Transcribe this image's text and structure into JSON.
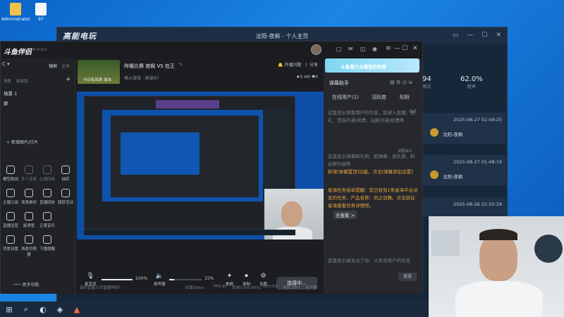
{
  "desktop": {
    "icons": [
      {
        "label": "Administrator",
        "icon": "folder-icon"
      },
      {
        "label": "97",
        "icon": "file-icon"
      }
    ]
  },
  "back_window": {
    "logo_text": "高能电玩",
    "title": "沈阳-夜枫 - 个人主页",
    "stats": [
      {
        "value": "94",
        "label": "场次"
      },
      {
        "value": "62.0%",
        "label": "胜率"
      }
    ],
    "matches": [
      {
        "datetime": "2025-08-27 02:09:25",
        "player": "沈阳-夜枫"
      },
      {
        "datetime": "2025-08-27 01:48:19",
        "player": "沈阳-夜枫"
      },
      {
        "datetime": "2025-08-26 22:50:29",
        "player": ""
      }
    ]
  },
  "app": {
    "name": "斗鱼伴侣",
    "version": "6.4.9.2",
    "sidebar": {
      "tabs": [
        "镜屏",
        "全屏"
      ],
      "section_a": "场景",
      "section_b": "画面层",
      "scene_item": "场景 1",
      "scene_sub": "屏",
      "add_scene": "新增图片/灯片",
      "tools": [
        {
          "label": "模型挑战",
          "icon": "shield-icon"
        },
        {
          "label": "多人连麦",
          "icon": "users-icon"
        },
        {
          "label": "主播回放",
          "icon": "replay-icon"
        },
        {
          "label": "抽奖",
          "icon": "gift-icon"
        },
        {
          "label": "主播口袋",
          "icon": "pocket-icon"
        },
        {
          "label": "场景素材",
          "icon": "scene-icon"
        },
        {
          "label": "直播回放",
          "icon": "clock-icon"
        },
        {
          "label": "跳跃活动",
          "icon": "jump-icon"
        },
        {
          "label": "直播运营",
          "icon": "ai-icon"
        },
        {
          "label": "旋律管",
          "icon": "music-icon"
        },
        {
          "label": "正版音乐",
          "icon": "download-icon"
        },
        {
          "label": "",
          "icon": "blank"
        },
        {
          "label": "背景设置",
          "icon": "bg-icon"
        },
        {
          "label": "场景切换器",
          "icon": "switch-icon"
        },
        {
          "label": "下播提醒",
          "icon": "bell-icon"
        },
        {
          "label": "",
          "icon": "blank"
        }
      ],
      "more": "更多功能"
    },
    "room": {
      "title": "昨晚比赛 夜枫 VS 包王",
      "category": "格斗游戏 · 斯曼97",
      "thumb_caption": "今日有凤来 双击",
      "broadcast_help": "开播问题",
      "share": "分享",
      "counts": [
        "0",
        "0",
        "0"
      ]
    },
    "controls": [
      {
        "label": "麦克风",
        "icon": "mic-icon",
        "value": "100%"
      },
      {
        "label": "扬声器",
        "icon": "speaker-icon",
        "value": "15%"
      },
      {
        "label": "美颜",
        "icon": "beauty-icon"
      },
      {
        "label": "录制",
        "icon": "record-icon"
      },
      {
        "label": "设置",
        "icon": "gear-icon"
      }
    ],
    "connect_button": "连接中...",
    "status": {
      "hint": "如何直播上手直播伴侣?",
      "bitrate": "码率0kb/s",
      "fps": "FPS:30",
      "drop": "丢帧0.0(0.00%)",
      "cpu": "CPU:5%",
      "mem": "内存:35%",
      "network": "未开播"
    },
    "right_panel": {
      "banner": "斗鱼潜力主播签约政策",
      "header": "弹幕助手",
      "tabs": [
        "在线用户(1)",
        "活跃度",
        "贴粉"
      ],
      "count_badge": "0.0",
      "count_badge2": "0页/0人",
      "placeholder_1": "这里显示观看用户的信息，如进入直播，送礼、贵族开通/续费，钻粉开通/续费等",
      "placeholder_2": "这里显示弹幕和礼物，如弹幕、送礼物、粉丝牌升级等",
      "notice_1": "新增[弹幕置顶]功能，点击[弹幕添加设置]",
      "notice_2": "星海任务接单提醒：您已收到1条星海平台派发的任务，产品名称：风之剑舞。点击前往星海查看任务详情吧。",
      "notice_link": "去查看 >",
      "placeholder_3": "这里显示被关注了你，以及该用户的信息",
      "send_button": "发送"
    }
  }
}
